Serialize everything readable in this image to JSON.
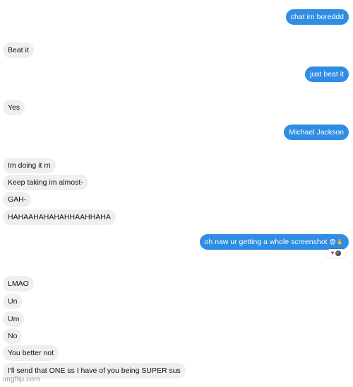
{
  "messages": [
    {
      "id": "m1",
      "side": "sent",
      "text": "chat im boreddd"
    },
    {
      "id": "m2",
      "side": "received",
      "text": "Beat it"
    },
    {
      "id": "m3",
      "side": "sent",
      "text": "just beat it"
    },
    {
      "id": "m4",
      "side": "received",
      "text": "Yes"
    },
    {
      "id": "m5",
      "side": "sent",
      "text": "Michael Jackson"
    },
    {
      "id": "m6",
      "side": "received",
      "text": "Im doing it rn"
    },
    {
      "id": "m7",
      "side": "received",
      "text": "Keep taking im almost-"
    },
    {
      "id": "m8",
      "side": "received",
      "text": "GAH-"
    },
    {
      "id": "m9",
      "side": "received",
      "text": "HAHAAHAHAHAHHAAHHAHA"
    },
    {
      "id": "m10",
      "side": "sent",
      "text": "oh naw ur getting a whole screenshot",
      "emoji": "😨🙏"
    },
    {
      "id": "m11",
      "side": "received",
      "text": "LMAO"
    },
    {
      "id": "m12",
      "side": "received",
      "text": "Un"
    },
    {
      "id": "m13",
      "side": "received",
      "text": "Um"
    },
    {
      "id": "m14",
      "side": "received",
      "text": "No"
    },
    {
      "id": "m15",
      "side": "received",
      "text": "You better not"
    },
    {
      "id": "m16",
      "side": "received",
      "text": "I'll send that ONE ss I have of you being SUPER sus"
    }
  ],
  "reactions": {
    "icons": [
      "heart-icon",
      "avatar"
    ],
    "heart_glyph": "♥",
    "heart_color": "#e0245e"
  },
  "colors": {
    "sent_bubble": "#2f8de4",
    "received_bubble": "#efefef"
  },
  "watermark": "imgflip.com"
}
